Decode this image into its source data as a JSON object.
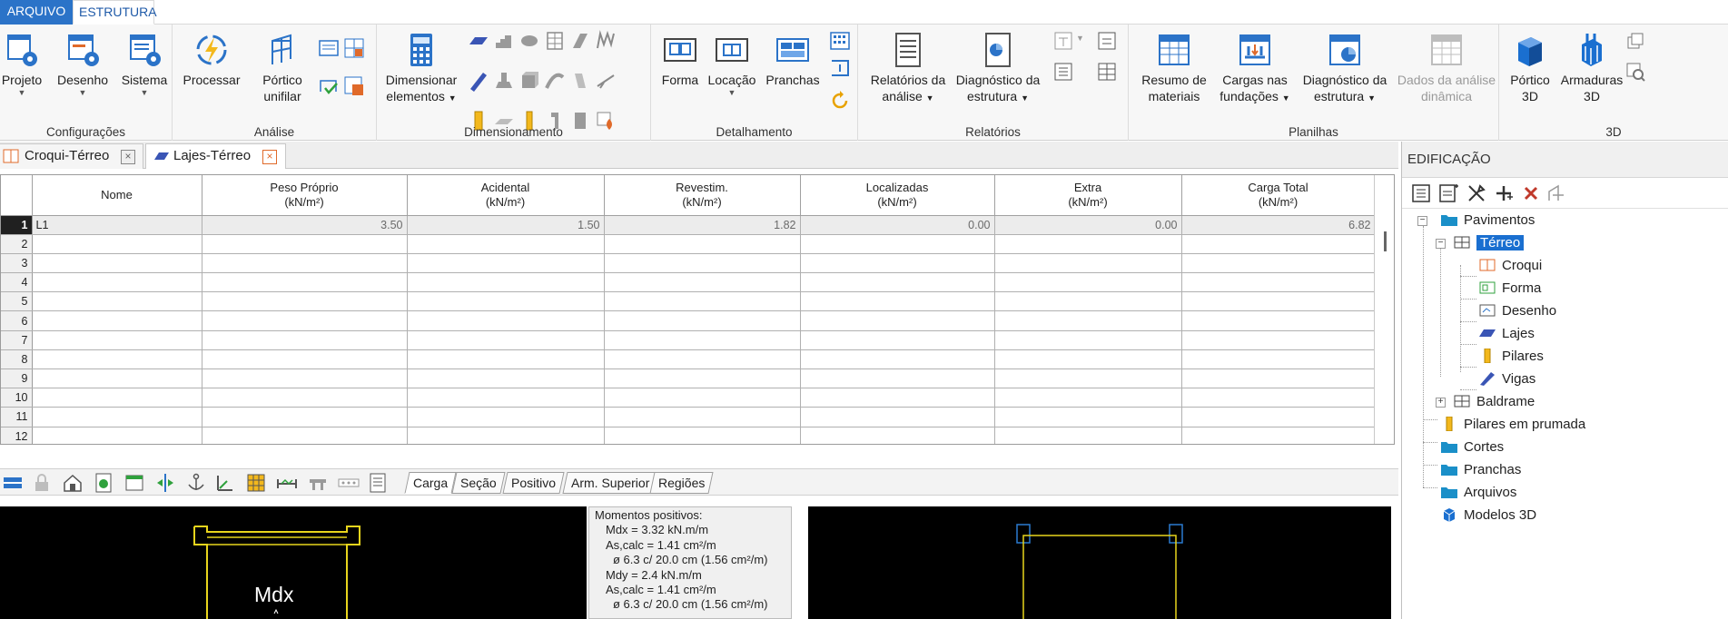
{
  "menu": {
    "file": "ARQUIVO",
    "active": "ESTRUTURA"
  },
  "ribbon": {
    "groups": {
      "configuracoes": "Configurações",
      "analise": "Análise",
      "dimensionamento": "Dimensionamento",
      "detalhamento": "Detalhamento",
      "relatorios": "Relatórios",
      "planilhas": "Planilhas",
      "tresd": "3D"
    },
    "buttons": {
      "projeto": "Projeto",
      "desenho": "Desenho",
      "sistema": "Sistema",
      "processar": "Processar",
      "portico_unifilar_1": "Pórtico",
      "portico_unifilar_2": "unifilar",
      "dimensionar_1": "Dimensionar",
      "dimensionar_2": "elementos",
      "forma": "Forma",
      "locacao": "Locação",
      "pranchas": "Pranchas",
      "relatorios_1": "Relatórios da",
      "relatorios_2": "análise",
      "diagnostico_1": "Diagnóstico da",
      "diagnostico_2": "estrutura",
      "resumo_1": "Resumo de",
      "resumo_2": "materiais",
      "cargas_1": "Cargas nas",
      "cargas_2": "fundações",
      "diagplan_1": "Diagnóstico da",
      "diagplan_2": "estrutura",
      "dados_1": "Dados da análise",
      "dados_2": "dinâmica",
      "portico3d_1": "Pórtico",
      "portico3d_2": "3D",
      "armaduras_1": "Armaduras",
      "armaduras_2": "3D"
    }
  },
  "doc_tabs": [
    {
      "label": "Croqui-Térreo"
    },
    {
      "label": "Lajes-Térreo"
    }
  ],
  "grid": {
    "columns": [
      {
        "name": "Nome",
        "unit": ""
      },
      {
        "name": "Peso Próprio",
        "unit": "(kN/m²)"
      },
      {
        "name": "Acidental",
        "unit": "(kN/m²)"
      },
      {
        "name": "Revestim.",
        "unit": "(kN/m²)"
      },
      {
        "name": "Localizadas",
        "unit": "(kN/m²)"
      },
      {
        "name": "Extra",
        "unit": "(kN/m²)"
      },
      {
        "name": "Carga Total",
        "unit": "(kN/m²)"
      }
    ],
    "row_numbers": [
      "1",
      "2",
      "3",
      "4",
      "5",
      "6",
      "7",
      "8",
      "9",
      "10",
      "11",
      "12"
    ],
    "row1": {
      "nome": "L1",
      "peso": "3.50",
      "acidental": "1.50",
      "revestim": "1.82",
      "localizadas": "0.00",
      "extra": "0.00",
      "total": "6.82"
    }
  },
  "sub_tabs": [
    "Carga",
    "Seção",
    "Positivo",
    "Arm. Superior",
    "Regiões"
  ],
  "canvas_label": "Mdx",
  "info": {
    "title": "Momentos positivos:",
    "lines": [
      "Mdx = 3.32 kN.m/m",
      "As,calc = 1.41 cm²/m",
      "ø 6.3 c/ 20.0 cm (1.56 cm²/m)",
      "Mdy = 2.4 kN.m/m",
      "As,calc = 1.41 cm²/m",
      "ø 6.3 c/ 20.0 cm (1.56 cm²/m)"
    ]
  },
  "panel": {
    "title": "EDIFICAÇÃO",
    "tree": {
      "pavimentos": "Pavimentos",
      "terreo": "Térreo",
      "croqui": "Croqui",
      "forma": "Forma",
      "desenho": "Desenho",
      "lajes": "Lajes",
      "pilares": "Pilares",
      "vigas": "Vigas",
      "baldrame": "Baldrame",
      "pilares_prumada": "Pilares em prumada",
      "cortes": "Cortes",
      "pranchas": "Pranchas",
      "arquivos": "Arquivos",
      "modelos3d": "Modelos 3D"
    }
  },
  "colors": {
    "accent": "#2b73c8",
    "selection": "#1a6fd0",
    "folder": "#1a8fc8",
    "canvas": "#000000",
    "drawing_yellow": "#e8d51c",
    "drawing_blue": "#2a7bd0"
  }
}
